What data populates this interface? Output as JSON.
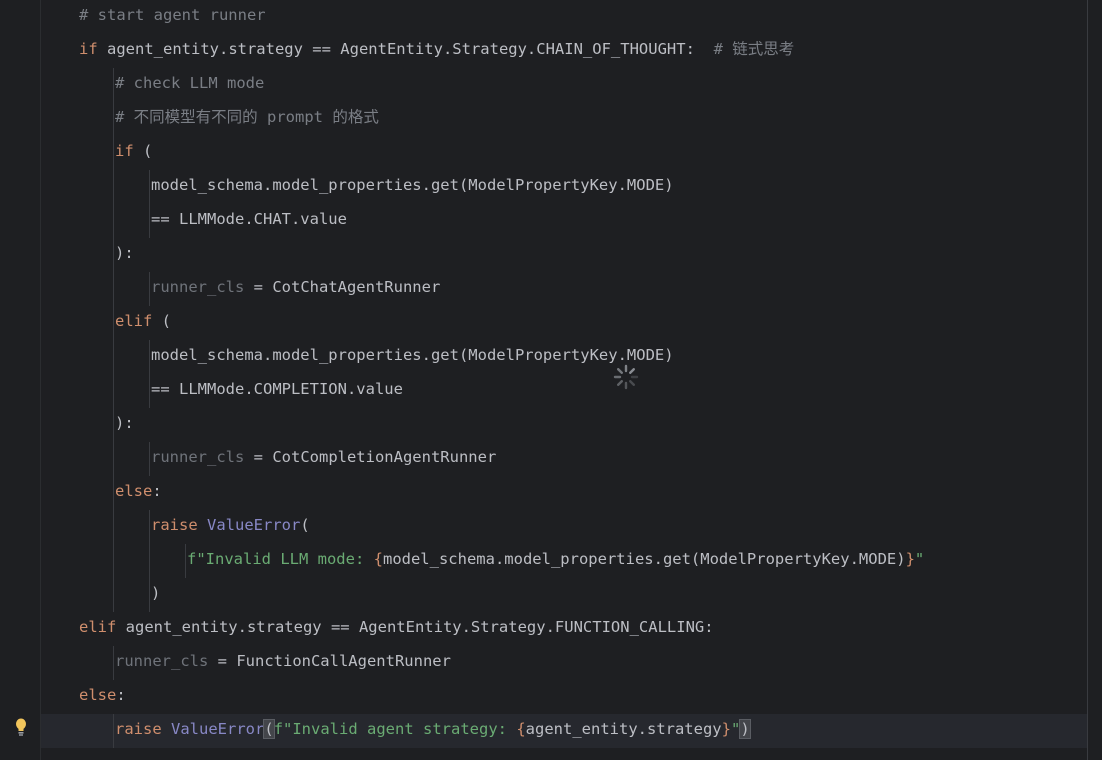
{
  "editor": {
    "lines": [
      {
        "indent": 1,
        "segments": [
          {
            "t": "# start agent runner",
            "c": "cm"
          }
        ]
      },
      {
        "indent": 1,
        "segments": [
          {
            "t": "if",
            "c": "kw"
          },
          {
            "t": " agent_entity.strategy == AgentEntity.Strategy.CHAIN_OF_THOUGHT:  ",
            "c": ""
          },
          {
            "t": "# 链式思考",
            "c": "cm"
          }
        ]
      },
      {
        "indent": 2,
        "segments": [
          {
            "t": "# check LLM mode",
            "c": "cm"
          }
        ]
      },
      {
        "indent": 2,
        "segments": [
          {
            "t": "# 不同模型有不同的 prompt 的格式",
            "c": "cm"
          }
        ]
      },
      {
        "indent": 2,
        "segments": [
          {
            "t": "if",
            "c": "kw"
          },
          {
            "t": " (",
            "c": ""
          }
        ]
      },
      {
        "indent": 3,
        "segments": [
          {
            "t": "model_schema.model_properties.get(ModelPropertyKey.MODE)",
            "c": ""
          }
        ]
      },
      {
        "indent": 3,
        "segments": [
          {
            "t": "== LLMMode.CHAT.value",
            "c": ""
          }
        ]
      },
      {
        "indent": 2,
        "segments": [
          {
            "t": "):",
            "c": ""
          }
        ]
      },
      {
        "indent": 3,
        "segments": [
          {
            "t": "runner_cls",
            "c": "unused"
          },
          {
            "t": " = CotChatAgentRunner",
            "c": ""
          }
        ]
      },
      {
        "indent": 2,
        "segments": [
          {
            "t": "elif",
            "c": "kw"
          },
          {
            "t": " (",
            "c": ""
          }
        ]
      },
      {
        "indent": 3,
        "segments": [
          {
            "t": "model_schema.model_properties.get(ModelPropertyKey.MODE)",
            "c": ""
          }
        ]
      },
      {
        "indent": 3,
        "segments": [
          {
            "t": "== LLMMode.COMPLETION.value",
            "c": ""
          }
        ]
      },
      {
        "indent": 2,
        "segments": [
          {
            "t": "):",
            "c": ""
          }
        ]
      },
      {
        "indent": 3,
        "segments": [
          {
            "t": "runner_cls",
            "c": "unused"
          },
          {
            "t": " = CotCompletionAgentRunner",
            "c": ""
          }
        ]
      },
      {
        "indent": 2,
        "segments": [
          {
            "t": "else",
            "c": "kw"
          },
          {
            "t": ":",
            "c": ""
          }
        ]
      },
      {
        "indent": 3,
        "segments": [
          {
            "t": "raise",
            "c": "kw"
          },
          {
            "t": " ",
            "c": ""
          },
          {
            "t": "ValueError",
            "c": "cls"
          },
          {
            "t": "(",
            "c": ""
          }
        ]
      },
      {
        "indent": 4,
        "segments": [
          {
            "t": "f\"Invalid LLM mode: ",
            "c": "str"
          },
          {
            "t": "{",
            "c": "brace"
          },
          {
            "t": "model_schema.model_properties.get(ModelPropertyKey.MODE)",
            "c": ""
          },
          {
            "t": "}",
            "c": "brace"
          },
          {
            "t": "\"",
            "c": "str"
          }
        ]
      },
      {
        "indent": 3,
        "segments": [
          {
            "t": ")",
            "c": ""
          }
        ]
      },
      {
        "indent": 1,
        "segments": [
          {
            "t": "elif",
            "c": "kw"
          },
          {
            "t": " agent_entity.strategy == AgentEntity.Strategy.FUNCTION_CALLING:",
            "c": ""
          }
        ]
      },
      {
        "indent": 2,
        "segments": [
          {
            "t": "runner_cls",
            "c": "unused"
          },
          {
            "t": " = FunctionCallAgentRunner",
            "c": ""
          }
        ]
      },
      {
        "indent": 1,
        "segments": [
          {
            "t": "else",
            "c": "kw"
          },
          {
            "t": ":",
            "c": ""
          }
        ]
      },
      {
        "indent": 2,
        "caret": true,
        "segments": [
          {
            "t": "raise",
            "c": "kw"
          },
          {
            "t": " ",
            "c": ""
          },
          {
            "t": "ValueError",
            "c": "cls"
          },
          {
            "t": "(",
            "c": "hl"
          },
          {
            "t": "f\"Invalid agent strategy: ",
            "c": "str"
          },
          {
            "t": "{",
            "c": "brace"
          },
          {
            "t": "agent_entity.strategy",
            "c": ""
          },
          {
            "t": "}",
            "c": "brace"
          },
          {
            "t": "\"",
            "c": "str"
          },
          {
            "t": ")",
            "c": "hl"
          }
        ]
      }
    ]
  },
  "icons": {
    "bulb": "lightbulb-icon",
    "spinner": "loading-spinner-icon"
  },
  "colors": {
    "background": "#1e1f22",
    "keyword": "#cf8e6d",
    "comment": "#7a7e85",
    "string": "#6aab73",
    "builtin": "#8888c6",
    "text": "#bcbec4"
  }
}
